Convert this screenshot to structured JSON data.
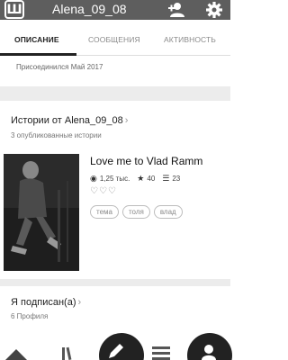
{
  "app": {
    "logo_letter": "Ш",
    "title": "Alena_09_08"
  },
  "tabs": [
    {
      "label": "ОПИСАНИЕ",
      "active": true
    },
    {
      "label": "СООБЩЕНИЯ",
      "active": false
    },
    {
      "label": "АКТИВНОСТЬ",
      "active": false
    }
  ],
  "about": {
    "joined": "Присоединился Май 2017"
  },
  "stories_section": {
    "title": "Истории от Alena_09_08",
    "subtitle": "3 опубликованные истории",
    "story": {
      "title": "Love me to Vlad Ramm",
      "reads": "1,25 тыс.",
      "votes": "40",
      "parts": "23",
      "hearts": "♡♡♡",
      "tags": [
        "тема",
        "толя",
        "влад"
      ]
    }
  },
  "following_section": {
    "title": "Я подписан(а)",
    "subtitle": "6 Профиля"
  },
  "icons": {
    "add_user": "add-user-icon",
    "settings": "gear-icon",
    "reads": "eye-icon",
    "votes": "star-icon",
    "parts": "list-icon"
  }
}
